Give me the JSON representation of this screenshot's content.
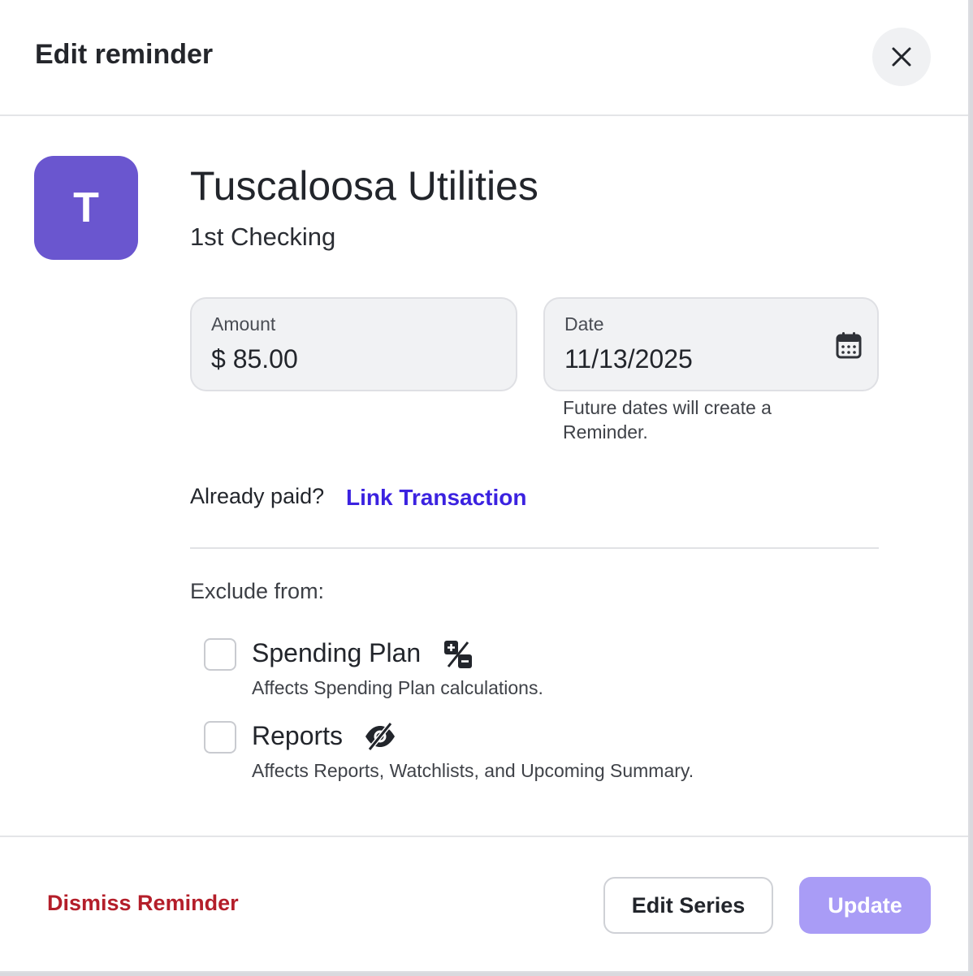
{
  "dialog": {
    "title": "Edit reminder",
    "close_icon": "close-icon"
  },
  "payee": {
    "avatar_letter": "T",
    "avatar_color": "#6a56cf",
    "name": "Tuscaloosa Utilities",
    "account": "1st Checking"
  },
  "amount": {
    "label": "Amount",
    "value": "$ 85.00"
  },
  "date": {
    "label": "Date",
    "value": "11/13/2025",
    "icon": "calendar-icon",
    "hint": "Future dates will create a Reminder."
  },
  "link": {
    "prompt": "Already paid?",
    "action": "Link Transaction"
  },
  "exclude": {
    "heading": "Exclude from:",
    "options": [
      {
        "label": "Spending Plan",
        "description": "Affects Spending Plan calculations.",
        "icon": "plus-minus-icon",
        "checked": false
      },
      {
        "label": "Reports",
        "description": "Affects Reports, Watchlists, and Upcoming Summary.",
        "icon": "eye-slash-icon",
        "checked": false
      }
    ]
  },
  "footer": {
    "dismiss_label": "Dismiss Reminder",
    "edit_series_label": "Edit Series",
    "update_label": "Update"
  },
  "colors": {
    "accent": "#3b22e0",
    "danger": "#b41e2a",
    "update_disabled": "#a99cf6"
  }
}
